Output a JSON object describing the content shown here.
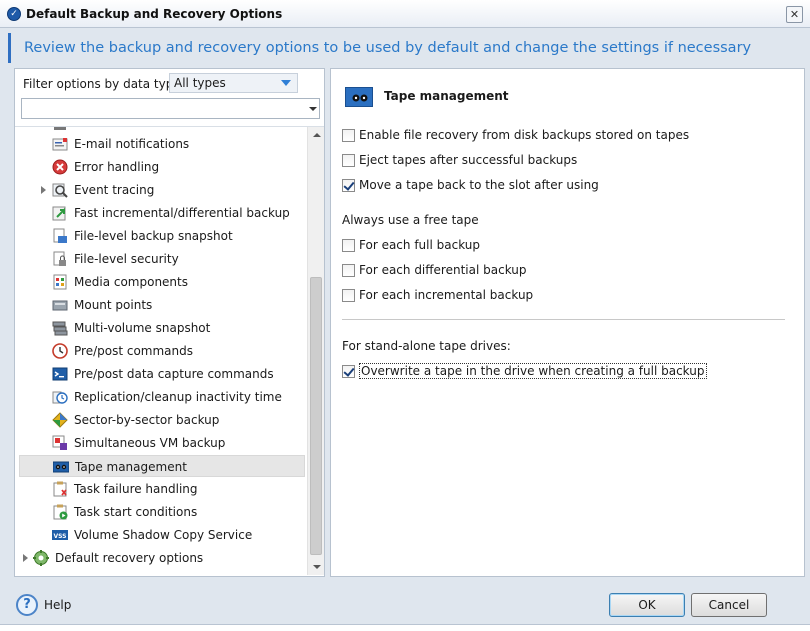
{
  "window": {
    "title": "Default Backup and Recovery Options",
    "close_glyph": "✕"
  },
  "header": {
    "text": "Review the backup and recovery options to be used by default and change the settings if necessary"
  },
  "filter": {
    "label": "Filter options by data type:",
    "selected": "All types"
  },
  "tree": {
    "items": [
      {
        "label": "E-mail notifications",
        "icon": "email-icon"
      },
      {
        "label": "Error handling",
        "icon": "error-icon"
      },
      {
        "label": "Event tracing",
        "icon": "event-tracing-icon"
      },
      {
        "label": "Fast incremental/differential backup",
        "icon": "fast-incremental-icon"
      },
      {
        "label": "File-level backup snapshot",
        "icon": "file-snapshot-icon"
      },
      {
        "label": "File-level security",
        "icon": "lock-icon"
      },
      {
        "label": "Media components",
        "icon": "media-components-icon"
      },
      {
        "label": "Mount points",
        "icon": "mount-points-icon"
      },
      {
        "label": "Multi-volume snapshot",
        "icon": "multi-volume-icon"
      },
      {
        "label": "Pre/post commands",
        "icon": "clock-icon"
      },
      {
        "label": "Pre/post data capture commands",
        "icon": "console-icon"
      },
      {
        "label": "Replication/cleanup inactivity time",
        "icon": "replication-icon"
      },
      {
        "label": "Sector-by-sector backup",
        "icon": "sector-icon"
      },
      {
        "label": "Simultaneous VM backup",
        "icon": "vm-icon"
      },
      {
        "label": "Tape management",
        "icon": "tape-icon"
      },
      {
        "label": "Task failure handling",
        "icon": "task-failure-icon"
      },
      {
        "label": "Task start conditions",
        "icon": "task-start-icon"
      },
      {
        "label": "Volume Shadow Copy Service",
        "icon": "vss-icon"
      }
    ],
    "recovery": {
      "label": "Default recovery options",
      "icon": "recovery-options-icon"
    }
  },
  "panel": {
    "title": "Tape management",
    "options": [
      {
        "label": "Enable file recovery from disk backups stored on tapes",
        "checked": false
      },
      {
        "label": "Eject tapes after successful backups",
        "checked": false
      },
      {
        "label": "Move a tape back to the slot after using",
        "checked": true
      }
    ],
    "free_tape_label": "Always use a free tape",
    "free_tape_options": [
      {
        "label": "For each full backup",
        "checked": false
      },
      {
        "label": "For each differential backup",
        "checked": false
      },
      {
        "label": "For each incremental backup",
        "checked": false
      }
    ],
    "standalone_label": "For stand-alone tape drives:",
    "standalone_option": {
      "label": "Overwrite a tape in the drive when creating a full backup",
      "checked": true
    }
  },
  "footer": {
    "help": "Help",
    "ok": "OK",
    "cancel": "Cancel"
  },
  "colors": {
    "accent": "#2b79c9",
    "selection": "#e6e6e6"
  }
}
